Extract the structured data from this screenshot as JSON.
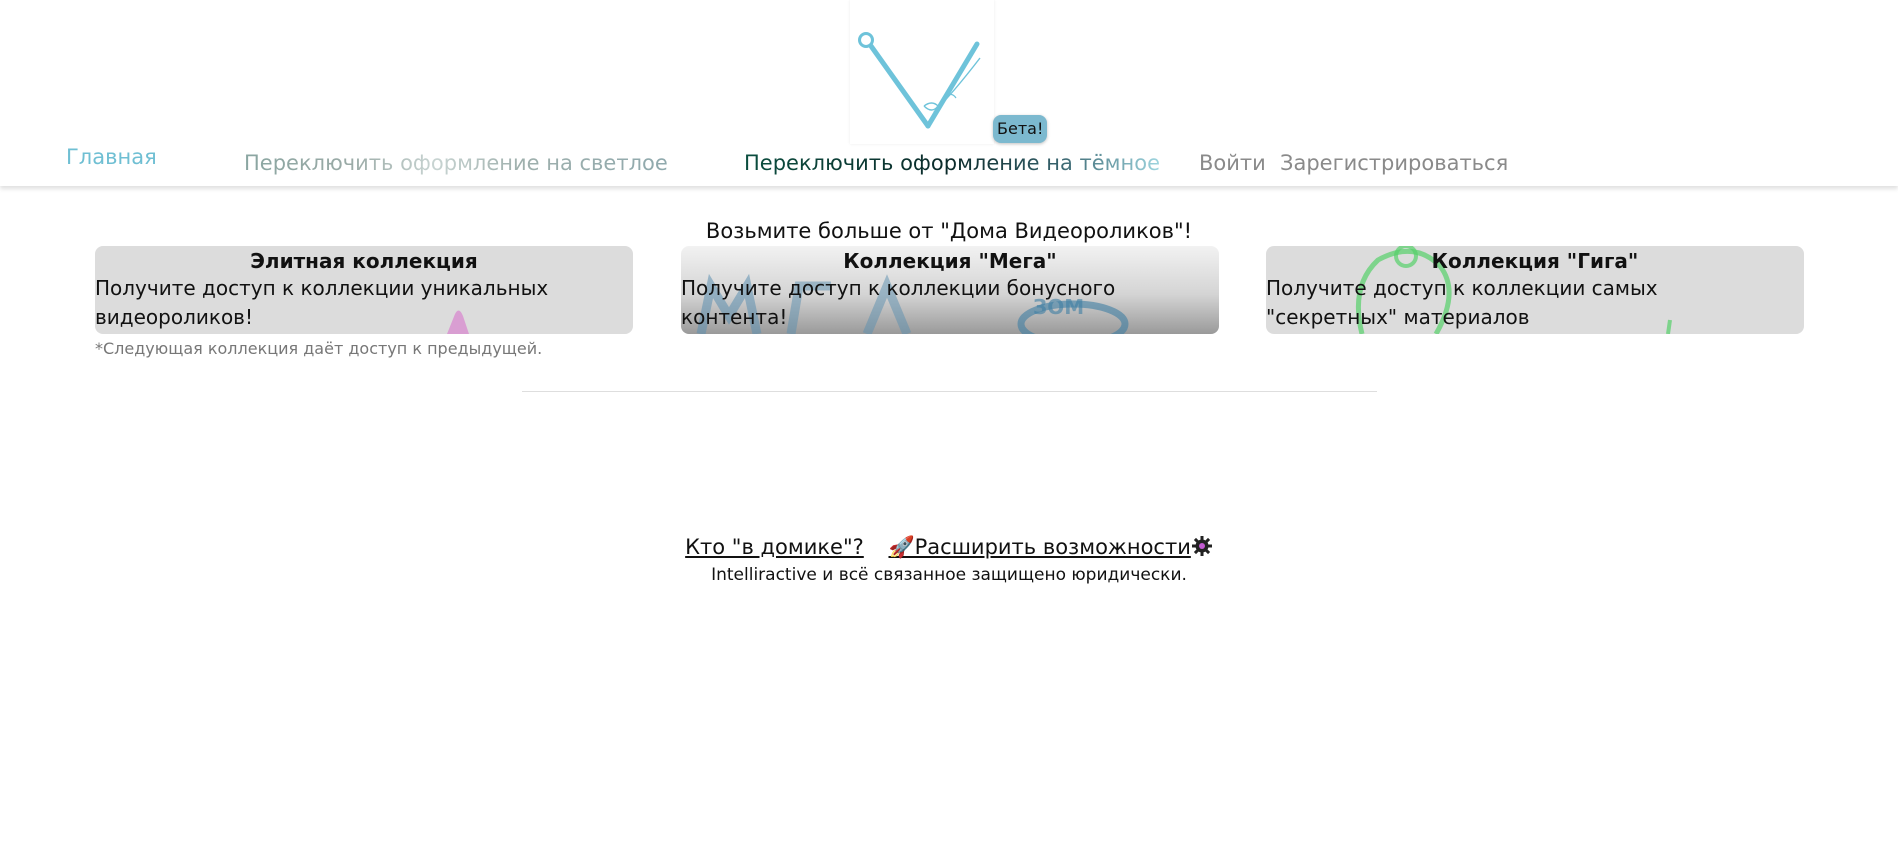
{
  "header": {
    "beta_label": "Бета!",
    "nav": {
      "home": "Главная",
      "light_theme": "Переключить оформление на светлое",
      "dark_theme": "Переключить оформление на тёмное",
      "login": "Войти",
      "register": "Зарегистрироваться"
    }
  },
  "main": {
    "heading": "Возьмите больше от \"Дома Видеороликов\"!",
    "cards": [
      {
        "title": "Элитная коллекция",
        "text": "Получите доступ к коллекции уникальных видеороликов!"
      },
      {
        "title": "Коллекция \"Мега\"",
        "text": "Получите доступ к коллекции бонусного контента!"
      },
      {
        "title": "Коллекция \"Гига\"",
        "text": "Получите доступ к коллекции самых \"секретных\" материалов"
      }
    ],
    "note": "*Следующая коллекция даёт доступ к предыдущей."
  },
  "footer": {
    "about_link": "Кто \"в домике\"?",
    "upgrade_link": "🚀Расширить возможности",
    "copyright": "Intelliractive и всё связанное защищено юридически."
  },
  "colors": {
    "accent": "#6fbfd3",
    "beta_bg": "#7cb9cf",
    "card_bg": "#dcdcdc"
  },
  "icons": [
    "logo-checkmark-icon",
    "rocket-icon",
    "gear-icon"
  ]
}
